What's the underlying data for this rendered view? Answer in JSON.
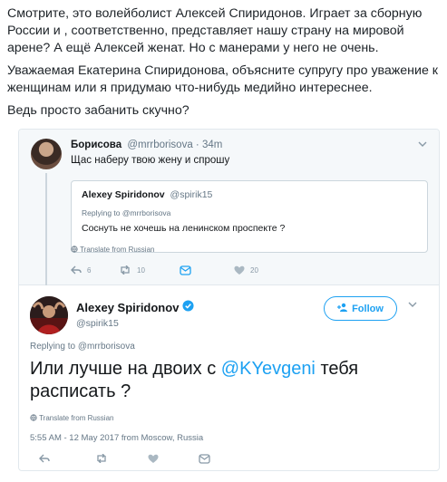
{
  "intro": {
    "p1": "Смотрите, это волейболист Алексей Спиридонов. Играет за сборную России и , соответственно, представляет нашу страну на мировой арене? А ещё Алексей женат. Но с манерами у него не очень.",
    "p2": "Уважаемая Екатерина Спиридонова, объясните супругу про уважение к женщинам или я придумаю что-нибудь медийно интереснее.",
    "p3": "Ведь просто забанить скучно?"
  },
  "quoted_tweet": {
    "name": "Борисова",
    "handle": "@mrrborisova",
    "separator": "·",
    "time": "34m",
    "text": "Щас наберу твою жену и спрошу",
    "inner": {
      "name": "Alexey Spiridonov",
      "handle": "@spirik15",
      "reply_prefix": "Replying to",
      "reply_handle": "@mrrborisova",
      "text": "Соснуть не хочешь на ленинском проспекте ?"
    },
    "translate": "Translate from Russian",
    "actions": {
      "reply_count": "6",
      "retweet_count": "10",
      "like_count": "20"
    }
  },
  "main_tweet": {
    "name": "Alexey Spiridonov",
    "handle": "@spirik15",
    "follow_label": "Follow",
    "reply_prefix": "Replying to",
    "reply_handle": "@mrrborisova",
    "text_before": "Или лучше на двоих с ",
    "mention": "@KYevgeni",
    "text_after": " тебя расписать ?",
    "translate": "Translate from Russian",
    "timestamp": "5:55 AM - 12 May 2017 from",
    "location": "Moscow, Russia"
  },
  "colors": {
    "accent": "#1da1f2",
    "muted": "#657786",
    "border": "#e1e8ed"
  },
  "icons": [
    "chevron-down-icon",
    "verified-icon",
    "globe-icon",
    "reply-icon",
    "retweet-icon",
    "dm-icon",
    "like-icon",
    "follow-person-icon"
  ]
}
